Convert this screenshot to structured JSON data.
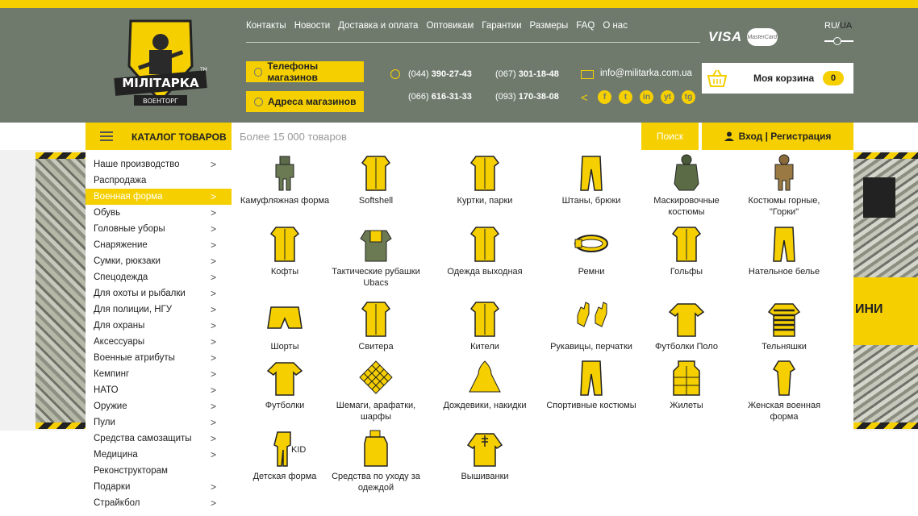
{
  "brand": {
    "logo_text": "МІЛІТАРКА",
    "logo_sub": "ВОЕНТОРГ",
    "tm": "TM"
  },
  "topnav": [
    "Контакты",
    "Новости",
    "Доставка и оплата",
    "Оптовикам",
    "Гарантии",
    "Размеры",
    "FAQ",
    "О нас"
  ],
  "payments": {
    "visa": "VISA",
    "mastercard": "MasterCard"
  },
  "lang": {
    "ru": "RU",
    "sep": "/",
    "ua": "UA"
  },
  "buttons": {
    "phones": "Телефоны магазинов",
    "addresses": "Адреса магазинов"
  },
  "phones": [
    {
      "code": "(044)",
      "num": "390-27-43"
    },
    {
      "code": "(067)",
      "num": "301-18-48"
    },
    {
      "code": "(066)",
      "num": "616-31-33"
    },
    {
      "code": "(093)",
      "num": "170-38-08"
    }
  ],
  "email": "info@militarka.com.ua",
  "social": [
    "f",
    "t",
    "in",
    "yt",
    "tg"
  ],
  "cart": {
    "label": "Моя корзина",
    "count": "0"
  },
  "catalog": {
    "title": "КАТАЛОГ ТОВАРОВ"
  },
  "search": {
    "placeholder": "Более 15 000 товаров",
    "button": "Поиск"
  },
  "login": {
    "label": "Вход | Регистрация"
  },
  "banner": {
    "text": "ИНИ"
  },
  "sidemenu": [
    {
      "label": "Наше производство",
      "arrow": ">"
    },
    {
      "label": "Распродажа",
      "arrow": ""
    },
    {
      "label": "Военная форма",
      "arrow": ">"
    },
    {
      "label": "Обувь",
      "arrow": ">"
    },
    {
      "label": "Головные уборы",
      "arrow": ">"
    },
    {
      "label": "Снаряжение",
      "arrow": ">"
    },
    {
      "label": "Сумки, рюкзаки",
      "arrow": ">"
    },
    {
      "label": "Спецодежда",
      "arrow": ">"
    },
    {
      "label": "Для охоты и рыбалки",
      "arrow": ">"
    },
    {
      "label": "Для полиции, НГУ",
      "arrow": ">"
    },
    {
      "label": "Для охраны",
      "arrow": ">"
    },
    {
      "label": "Аксессуары",
      "arrow": ">"
    },
    {
      "label": "Военные атрибуты",
      "arrow": ">"
    },
    {
      "label": "Кемпинг",
      "arrow": ">"
    },
    {
      "label": "НАТО",
      "arrow": ">"
    },
    {
      "label": "Оружие",
      "arrow": ">"
    },
    {
      "label": "Пули",
      "arrow": ">"
    },
    {
      "label": "Средства самозащиты",
      "arrow": ">"
    },
    {
      "label": "Медицина",
      "arrow": ">"
    },
    {
      "label": "Реконструкторам",
      "arrow": ""
    },
    {
      "label": "Подарки",
      "arrow": ">"
    },
    {
      "label": "Страйкбол",
      "arrow": ">"
    }
  ],
  "submenu": [
    {
      "label": "Камуфляжная форма",
      "icon": "camo-uniform-icon"
    },
    {
      "label": "Softshell",
      "icon": "softshell-icon"
    },
    {
      "label": "Куртки, парки",
      "icon": "jacket-icon"
    },
    {
      "label": "Штаны, брюки",
      "icon": "pants-icon"
    },
    {
      "label": "Маскировочные костюмы",
      "icon": "ghillie-suit-icon"
    },
    {
      "label": "Костюмы горные, \"Горки\"",
      "icon": "mountain-suit-icon"
    },
    {
      "label": "Кофты",
      "icon": "sweatshirt-icon"
    },
    {
      "label": "Тактические рубашки Ubacs",
      "icon": "tactical-shirt-icon"
    },
    {
      "label": "Одежда выходная",
      "icon": "dress-uniform-icon"
    },
    {
      "label": "Ремни",
      "icon": "belt-icon"
    },
    {
      "label": "Гольфы",
      "icon": "turtleneck-icon"
    },
    {
      "label": "Нательное белье",
      "icon": "underwear-icon"
    },
    {
      "label": "Шорты",
      "icon": "shorts-icon"
    },
    {
      "label": "Свитера",
      "icon": "sweater-icon"
    },
    {
      "label": "Кители",
      "icon": "tunic-icon"
    },
    {
      "label": "Рукавицы, перчатки",
      "icon": "gloves-icon"
    },
    {
      "label": "Футболки Поло",
      "icon": "polo-icon"
    },
    {
      "label": "Тельняшки",
      "icon": "striped-shirt-icon"
    },
    {
      "label": "Футболки",
      "icon": "tshirt-icon"
    },
    {
      "label": "Шемаги, арафатки, шарфы",
      "icon": "shemagh-icon"
    },
    {
      "label": "Дождевики, накидки",
      "icon": "raincoat-icon"
    },
    {
      "label": "Спортивные костюмы",
      "icon": "tracksuit-icon"
    },
    {
      "label": "Жилеты",
      "icon": "vest-icon"
    },
    {
      "label": "Женская военная форма",
      "icon": "womens-uniform-icon"
    },
    {
      "label": "Детская форма",
      "icon": "kids-uniform-icon",
      "badge": "KID"
    },
    {
      "label": "Средства по уходу за одеждой",
      "icon": "detergent-icon"
    },
    {
      "label": "Вышиванки",
      "icon": "vyshyvanka-icon"
    }
  ],
  "colors": {
    "accent": "#f5cf00",
    "header": "#6f7a6d",
    "text": "#222222"
  }
}
